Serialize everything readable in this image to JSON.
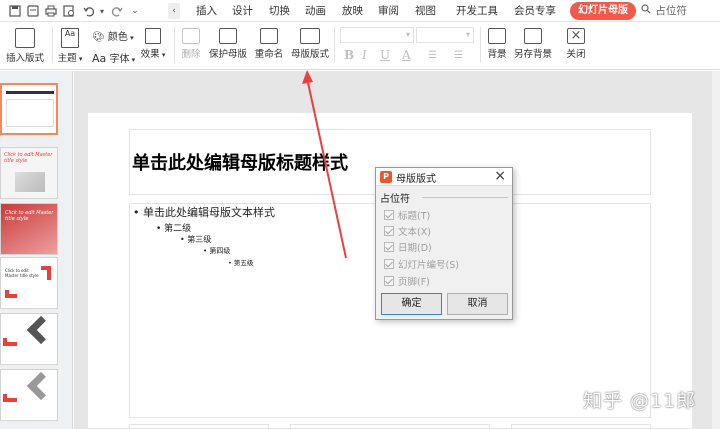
{
  "quick_access": {
    "icons": [
      "save-icon",
      "print-preview-icon",
      "print-icon",
      "export-icon",
      "undo-icon",
      "redo-icon",
      "customize-icon",
      "collapse-icon"
    ]
  },
  "menu": {
    "items": [
      "插入",
      "设计",
      "切换",
      "动画",
      "放映",
      "审阅",
      "视图",
      "开发工具",
      "会员专享"
    ],
    "active": "幻灯片母版",
    "search": "占位符"
  },
  "ribbon": {
    "insert_layout": "插入版式",
    "theme": "主题",
    "colors": "颜色",
    "fonts": "字体",
    "effects": "效果",
    "fonts_prefix": "Aa",
    "delete": "删除",
    "protect_master": "保护母版",
    "rename": "重命名",
    "master_layout": "母版版式",
    "background": "背景",
    "save_background": "另存背景",
    "close": "关闭",
    "format_glyphs": [
      "B",
      "I",
      "U",
      "A"
    ]
  },
  "slide": {
    "title": "单击此处编辑母版标题样式",
    "levels": [
      "单击此处编辑母版文本样式",
      "第二级",
      "第三级",
      "第四级",
      "第五级"
    ]
  },
  "dialog": {
    "title": "母版版式",
    "group_label": "占位符",
    "options": [
      "标题(T)",
      "文本(X)",
      "日期(D)",
      "幻灯片编号(S)",
      "页脚(F)"
    ],
    "ok": "确定",
    "cancel": "取消"
  },
  "thumbs": {
    "slide2_text": "Click to edit Master title style",
    "slide3_text": "Click to edit Master title style",
    "slide4_text": "Click to edit Master title style"
  },
  "watermark": "知乎 @11郎",
  "colors": {
    "accent": "#f15a4b",
    "arrow": "#e8413c"
  }
}
